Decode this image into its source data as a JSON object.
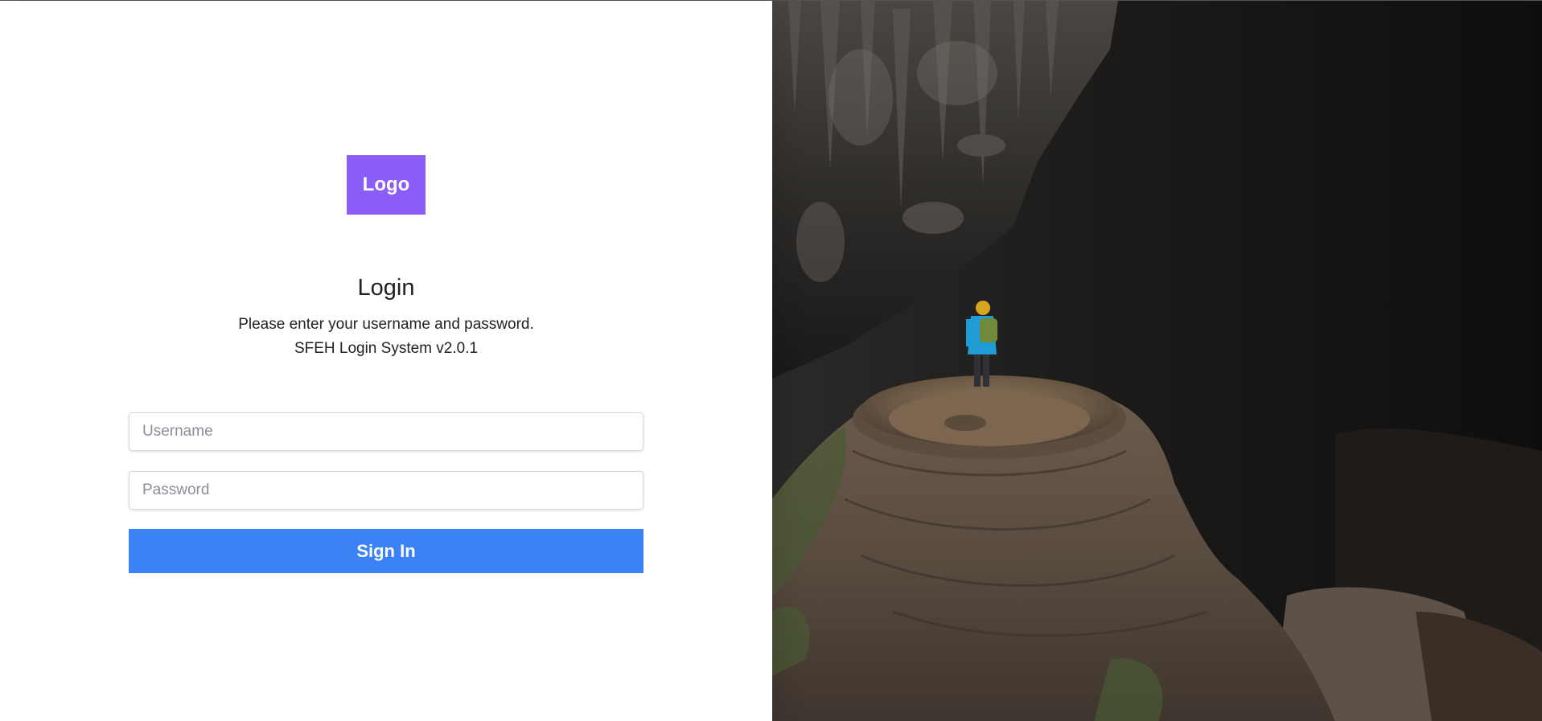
{
  "logo": {
    "label": "Logo",
    "color": "#8b5cf6"
  },
  "login": {
    "title": "Login",
    "subtitle_line1": "Please enter your username and password.",
    "subtitle_line2": "SFEH Login System v2.0.1"
  },
  "form": {
    "username_placeholder": "Username",
    "username_value": "",
    "password_placeholder": "Password",
    "password_value": "",
    "signin_label": "Sign In",
    "signin_color": "#3b82f6"
  },
  "hero_image": {
    "subject": "hiker standing on rock formation inside dark cave",
    "icon": "cave-photo"
  }
}
